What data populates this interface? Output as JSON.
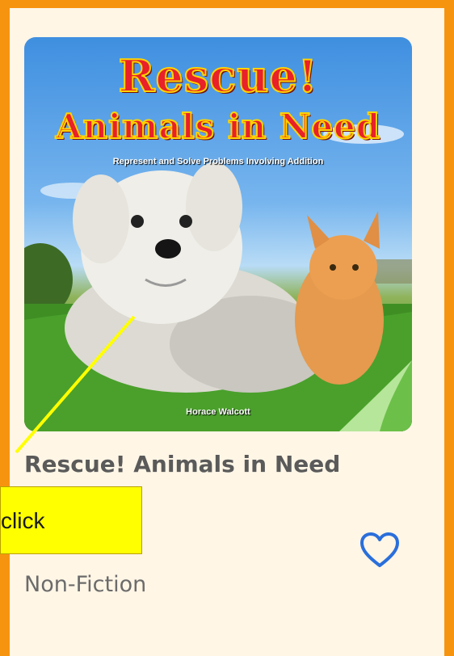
{
  "book": {
    "cover": {
      "title_line1": "Rescue!",
      "title_line2": "Animals in Need",
      "subtitle": "Represent and Solve Problems Involving Addition",
      "author": "Horace Walcott"
    },
    "title": "Rescue! Animals in Need",
    "genre": "Non-Fiction",
    "favorite_icon": "heart-outline-icon"
  },
  "annotation": {
    "label": "click",
    "color": "#ffff00"
  },
  "colors": {
    "frame": "#f7940f",
    "card": "#fff6e6",
    "heart": "#2a6fdb"
  }
}
